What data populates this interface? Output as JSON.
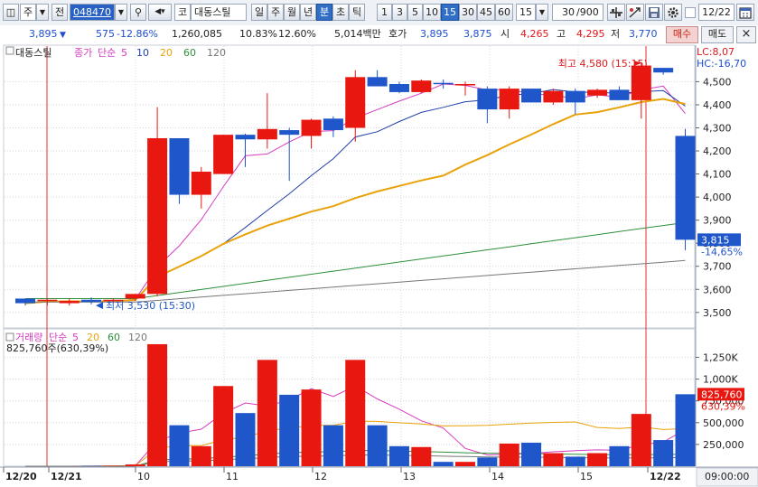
{
  "toolbar": {
    "icon_btn": "◫",
    "market": "주",
    "market_arrow": "▼",
    "prev": "전",
    "code": "048470",
    "search_icon": "⚲",
    "speaker_icon": "◀▾",
    "kospi": "코",
    "stock_name": "대동스틸",
    "period_tabs": [
      "일",
      "주",
      "월",
      "년",
      "분",
      "초",
      "틱"
    ],
    "period_active": "분",
    "interval_tabs": [
      "1",
      "3",
      "5",
      "10",
      "15",
      "30",
      "45",
      "60"
    ],
    "interval_active": "15",
    "interval_value": "15",
    "count_value": "30",
    "count_total": "/900",
    "date_value": "12/22",
    "icons": [
      "crosshair-icon",
      "tools-icon",
      "save-icon",
      "gear-icon"
    ]
  },
  "info": {
    "price": "3,895",
    "down_arrow": "▼",
    "change": "575",
    "change_pct": "-12.86%",
    "volume": "1,260,085",
    "pct1": "10.83%",
    "pct2": "12.60%",
    "amount": "5,014백만",
    "hoga_label": "호가",
    "ask": "3,895",
    "bid": "3,875",
    "open_label": "시",
    "open": "4,265",
    "high_label": "고",
    "high": "4,295",
    "low_label": "저",
    "low": "3,770",
    "buy_label": "매수",
    "sell_label": "매도",
    "close_label": "×"
  },
  "chart_data": {
    "type": "candlestick",
    "stock": "대동스틸",
    "price_legend": [
      "종가",
      "단순",
      "5",
      "10",
      "20",
      "60",
      "120"
    ],
    "volume_legend": [
      "거래량",
      "단순",
      "5",
      "20",
      "60",
      "120"
    ],
    "volume_readout": "825,760주(630,39%)",
    "lc": "LC:8,07",
    "hc": "HC:-16,70",
    "y_ticks": [
      "4,500",
      "4,400",
      "4,300",
      "4,200",
      "4,100",
      "4,000",
      "3,900",
      "3,800",
      "3,700",
      "3,600",
      "3,500"
    ],
    "y_ticks_values": [
      4500,
      4400,
      4300,
      4200,
      4100,
      4000,
      3900,
      3800,
      3700,
      3600,
      3500
    ],
    "ylim": [
      3460,
      4580
    ],
    "vol_ticks": [
      "1,250K",
      "1,000K",
      "750,000",
      "500,000",
      "250,000"
    ],
    "vol_tick_values": [
      1250000,
      1000000,
      750000,
      500000,
      250000
    ],
    "vol_ylim": [
      0,
      1410000
    ],
    "x_labels": [
      "12/20",
      "12/21",
      "10",
      "11",
      "12",
      "13",
      "14",
      "15",
      "12/22"
    ],
    "current_price_tag": "3,815",
    "current_pct_tag": "-14,65%",
    "current_vol_tag": "825,760",
    "current_vol_pct": "630,39%",
    "high_annotation": "최고 4,580 (15:15)",
    "low_annotation": "최저 3,530 (15:30)",
    "time_readout": "09:00:00",
    "candles": [
      {
        "o": 3560,
        "h": 3560,
        "l": 3530,
        "c": 3540,
        "v": 0
      },
      {
        "o": 3550,
        "h": 3560,
        "l": 3530,
        "c": 3555,
        "v": 0
      },
      {
        "o": 3540,
        "h": 3560,
        "l": 3530,
        "c": 3550,
        "v": 0
      },
      {
        "o": 3555,
        "h": 3565,
        "l": 3535,
        "c": 3545,
        "v": 5000
      },
      {
        "o": 3550,
        "h": 3560,
        "l": 3540,
        "c": 3555,
        "v": 5000
      },
      {
        "o": 3560,
        "h": 3580,
        "l": 3550,
        "c": 3580,
        "v": 20000
      },
      {
        "o": 3580,
        "h": 4390,
        "l": 3570,
        "c": 4255,
        "v": 1400000
      },
      {
        "o": 4255,
        "h": 4255,
        "l": 3970,
        "c": 4010,
        "v": 470000
      },
      {
        "o": 4010,
        "h": 4130,
        "l": 3950,
        "c": 4110,
        "v": 230000
      },
      {
        "o": 4100,
        "h": 4270,
        "l": 4100,
        "c": 4270,
        "v": 920000
      },
      {
        "o": 4270,
        "h": 4275,
        "l": 4130,
        "c": 4250,
        "v": 610000
      },
      {
        "o": 4250,
        "h": 4450,
        "l": 4210,
        "c": 4295,
        "v": 1220000
      },
      {
        "o": 4290,
        "h": 4300,
        "l": 4070,
        "c": 4270,
        "v": 820000
      },
      {
        "o": 4265,
        "h": 4340,
        "l": 4210,
        "c": 4335,
        "v": 880000
      },
      {
        "o": 4340,
        "h": 4350,
        "l": 4260,
        "c": 4290,
        "v": 470000
      },
      {
        "o": 4300,
        "h": 4550,
        "l": 4240,
        "c": 4520,
        "v": 1220000
      },
      {
        "o": 4520,
        "h": 4550,
        "l": 4480,
        "c": 4480,
        "v": 470000
      },
      {
        "o": 4490,
        "h": 4500,
        "l": 4450,
        "c": 4455,
        "v": 230000
      },
      {
        "o": 4455,
        "h": 4510,
        "l": 4450,
        "c": 4505,
        "v": 220000
      },
      {
        "o": 4495,
        "h": 4510,
        "l": 4470,
        "c": 4490,
        "v": 50000
      },
      {
        "o": 4490,
        "h": 4500,
        "l": 4440,
        "c": 4490,
        "v": 50000
      },
      {
        "o": 4470,
        "h": 4480,
        "l": 4320,
        "c": 4380,
        "v": 100000
      },
      {
        "o": 4380,
        "h": 4480,
        "l": 4340,
        "c": 4470,
        "v": 260000
      },
      {
        "o": 4470,
        "h": 4470,
        "l": 4410,
        "c": 4410,
        "v": 270000
      },
      {
        "o": 4410,
        "h": 4470,
        "l": 4400,
        "c": 4460,
        "v": 150000
      },
      {
        "o": 4460,
        "h": 4470,
        "l": 4360,
        "c": 4410,
        "v": 110000
      },
      {
        "o": 4440,
        "h": 4470,
        "l": 4430,
        "c": 4465,
        "v": 150000
      },
      {
        "o": 4465,
        "h": 4480,
        "l": 4420,
        "c": 4420,
        "v": 230000
      },
      {
        "o": 4420,
        "h": 4580,
        "l": 4340,
        "c": 4570,
        "v": 600000
      },
      {
        "o": 4560,
        "h": 4560,
        "l": 4530,
        "c": 4540,
        "v": 300000
      },
      {
        "o": 4265,
        "h": 4295,
        "l": 3770,
        "c": 3815,
        "v": 825760
      }
    ]
  }
}
